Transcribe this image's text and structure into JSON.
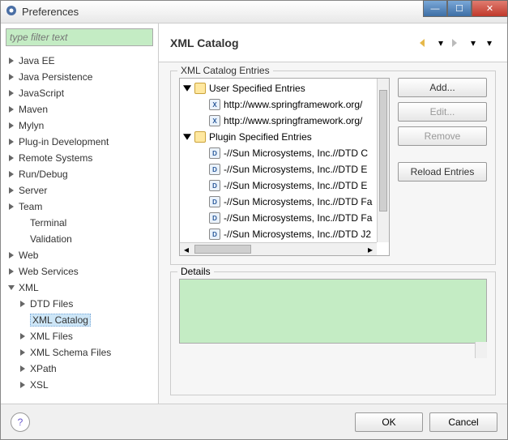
{
  "window": {
    "title": "Preferences"
  },
  "filter": {
    "placeholder": "type filter text"
  },
  "tree": {
    "items": [
      {
        "label": "Java EE",
        "exp": "closed",
        "indent": 0
      },
      {
        "label": "Java Persistence",
        "exp": "closed",
        "indent": 0
      },
      {
        "label": "JavaScript",
        "exp": "closed",
        "indent": 0
      },
      {
        "label": "Maven",
        "exp": "closed",
        "indent": 0
      },
      {
        "label": "Mylyn",
        "exp": "closed",
        "indent": 0
      },
      {
        "label": "Plug-in Development",
        "exp": "closed",
        "indent": 0
      },
      {
        "label": "Remote Systems",
        "exp": "closed",
        "indent": 0
      },
      {
        "label": "Run/Debug",
        "exp": "closed",
        "indent": 0
      },
      {
        "label": "Server",
        "exp": "closed",
        "indent": 0
      },
      {
        "label": "Team",
        "exp": "closed",
        "indent": 0
      },
      {
        "label": "Terminal",
        "exp": "none",
        "indent": 1
      },
      {
        "label": "Validation",
        "exp": "none",
        "indent": 1
      },
      {
        "label": "Web",
        "exp": "closed",
        "indent": 0
      },
      {
        "label": "Web Services",
        "exp": "closed",
        "indent": 0
      },
      {
        "label": "XML",
        "exp": "open",
        "indent": 0
      },
      {
        "label": "DTD Files",
        "exp": "closed",
        "indent": 1
      },
      {
        "label": "XML Catalog",
        "exp": "none",
        "indent": 1,
        "selected": true
      },
      {
        "label": "XML Files",
        "exp": "closed",
        "indent": 1
      },
      {
        "label": "XML Schema Files",
        "exp": "closed",
        "indent": 1
      },
      {
        "label": "XPath",
        "exp": "closed",
        "indent": 1
      },
      {
        "label": "XSL",
        "exp": "closed",
        "indent": 1
      }
    ]
  },
  "header": {
    "title": "XML Catalog"
  },
  "entries": {
    "legend": "XML Catalog Entries",
    "rows": [
      {
        "type": "group",
        "exp": "open",
        "label": "User Specified Entries"
      },
      {
        "type": "entry",
        "icon": "X",
        "label": "http://www.springframework.org/"
      },
      {
        "type": "entry",
        "icon": "X",
        "label": "http://www.springframework.org/"
      },
      {
        "type": "group",
        "exp": "open",
        "label": "Plugin Specified Entries"
      },
      {
        "type": "entry",
        "icon": "D",
        "label": "-//Sun Microsystems, Inc.//DTD C"
      },
      {
        "type": "entry",
        "icon": "D",
        "label": "-//Sun Microsystems, Inc.//DTD E"
      },
      {
        "type": "entry",
        "icon": "D",
        "label": "-//Sun Microsystems, Inc.//DTD E"
      },
      {
        "type": "entry",
        "icon": "D",
        "label": "-//Sun Microsystems, Inc.//DTD Fa"
      },
      {
        "type": "entry",
        "icon": "D",
        "label": "-//Sun Microsystems, Inc.//DTD Fa"
      },
      {
        "type": "entry",
        "icon": "D",
        "label": "-//Sun Microsystems, Inc.//DTD J2"
      }
    ]
  },
  "buttons": {
    "add": "Add...",
    "edit": "Edit...",
    "remove": "Remove",
    "reload": "Reload Entries"
  },
  "details": {
    "legend": "Details"
  },
  "footer": {
    "ok": "OK",
    "cancel": "Cancel"
  }
}
